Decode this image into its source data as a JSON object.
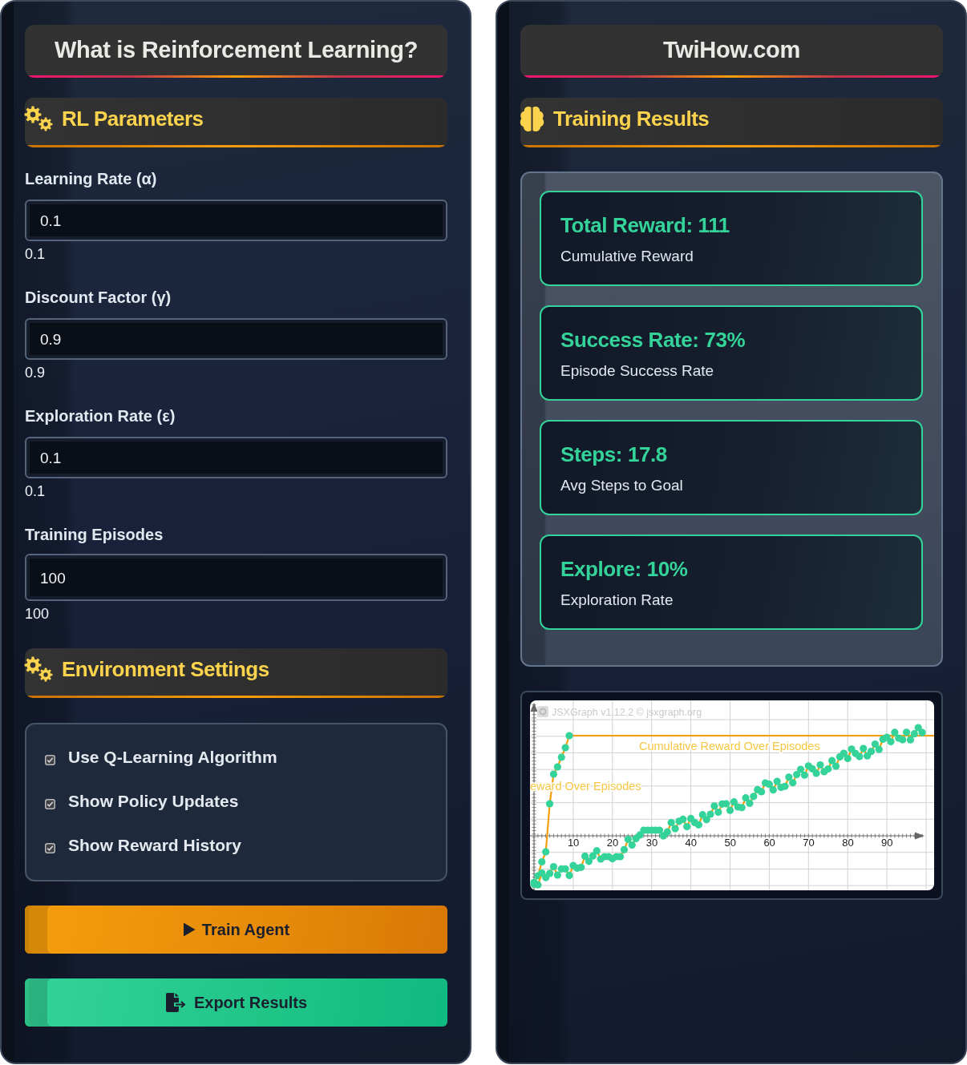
{
  "left_panel": {
    "title": "What is Reinforcement Learning?",
    "parameters_section": {
      "heading": "RL Parameters",
      "fields": [
        {
          "label": "Learning Rate (α)",
          "value": "0.1",
          "reading": "0.1"
        },
        {
          "label": "Discount Factor (γ)",
          "value": "0.9",
          "reading": "0.9"
        },
        {
          "label": "Exploration Rate (ε)",
          "value": "0.1",
          "reading": "0.1"
        },
        {
          "label": "Training Episodes",
          "value": "100",
          "reading": "100"
        }
      ]
    },
    "environment_section": {
      "heading": "Environment Settings",
      "options": [
        {
          "label": "Use Q-Learning Algorithm",
          "checked": true
        },
        {
          "label": "Show Policy Updates",
          "checked": true
        },
        {
          "label": "Show Reward History",
          "checked": true
        }
      ]
    },
    "buttons": [
      {
        "kind": "train",
        "label": "Train Agent"
      },
      {
        "kind": "export",
        "label": "Export Results"
      }
    ]
  },
  "right_panel": {
    "title": "TwiHow.com",
    "results_section": {
      "heading": "Training Results",
      "cards": [
        {
          "value": "Total Reward: 111",
          "caption": "Cumulative Reward"
        },
        {
          "value": "Success Rate: 73%",
          "caption": "Episode Success Rate"
        },
        {
          "value": "Steps: 17.8",
          "caption": "Avg Steps to Goal"
        },
        {
          "value": "Explore: 10%",
          "caption": "Exploration Rate"
        }
      ]
    },
    "chart": {
      "attribution": "JSXGraph v1.12.2 © jsxgraph.org",
      "title": "Cumulative Reward Over Episodes",
      "partial_label": "eward Over Episodes",
      "x_tick_labels": [
        "10",
        "20",
        "30",
        "40",
        "50",
        "60",
        "70",
        "80",
        "90"
      ]
    }
  }
}
